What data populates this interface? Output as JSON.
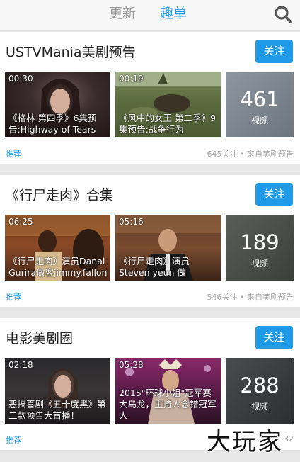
{
  "header": {
    "tab_update": "更新",
    "tab_playlist": "趣单",
    "search_icon": "search-icon"
  },
  "cards": [
    {
      "title": "USTVMania美剧预告",
      "follow": "关注",
      "videos": [
        {
          "duration": "00:30",
          "caption": "《格林 第四季》6集预告:Highway of Tears"
        },
        {
          "duration": "00:19",
          "caption": "《风中的女王 第二季》9集预告:战争行为"
        }
      ],
      "count": "461",
      "count_label": "视频",
      "tag": "推荐",
      "meta": "645关注 • 来自美剧预告"
    },
    {
      "title": "《行尸走肉》合集",
      "follow": "关注",
      "videos": [
        {
          "duration": "06:25",
          "caption": "《行尸走肉》演员Danai Gurira做客jimmy.fallon"
        },
        {
          "duration": "05:16",
          "caption": "《行尸走肉》演员Steven yeun 做"
        }
      ],
      "count": "189",
      "count_label": "视频",
      "tag": "推荐",
      "meta": "546关注 • 来自美剧预告"
    },
    {
      "title": "电影美剧圈",
      "follow": "关注",
      "videos": [
        {
          "duration": "02:18",
          "caption": "恶搞喜剧《五十度黑》第二款预告大首播！"
        },
        {
          "duration": "05:28",
          "caption": "2015\"环球小姐\"冠军赛大乌龙，主持人念错冠军人"
        }
      ],
      "count": "288",
      "count_label": "视频",
      "tag": "推荐",
      "meta": "32"
    }
  ],
  "watermark": "大玩家",
  "colors": {
    "accent": "#1e9ae6",
    "background": "#e8e8e8",
    "card": "#ffffff"
  }
}
